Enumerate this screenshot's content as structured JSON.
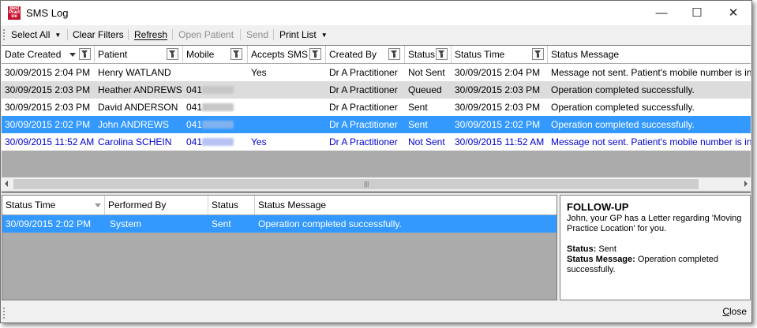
{
  "window": {
    "title": "SMS Log",
    "icon_text": "Best Practice",
    "controls": {
      "minimize": "—",
      "maximize": "☐",
      "close": "✕"
    }
  },
  "toolbar": {
    "select_all": "Select All",
    "clear_filters": "Clear Filters",
    "refresh": "Refresh",
    "open_patient": "Open Patient",
    "send": "Send",
    "print_list": "Print List"
  },
  "log_table": {
    "columns": [
      "Date Created",
      "Patient",
      "Mobile",
      "Accepts SMS",
      "Created By",
      "Status",
      "Status Time",
      "Status Message"
    ],
    "rows": [
      {
        "date": "30/09/2015 2:04 PM",
        "patient": "Henry WATLAND",
        "mobile": "",
        "accepts": "Yes",
        "created_by": "Dr A Practitioner",
        "status": "Not Sent",
        "status_time": "30/09/2015 2:04 PM",
        "message": "Message not sent. Patient's mobile number is invalid."
      },
      {
        "date": "30/09/2015 2:03 PM",
        "patient": "Heather ANDREWS",
        "mobile": "041",
        "accepts": "",
        "created_by": "Dr A Practitioner",
        "status": "Queued",
        "status_time": "30/09/2015 2:03 PM",
        "message": "Operation completed successfully."
      },
      {
        "date": "30/09/2015 2:03 PM",
        "patient": "David ANDERSON",
        "mobile": "041",
        "accepts": "",
        "created_by": "Dr A Practitioner",
        "status": "Sent",
        "status_time": "30/09/2015 2:03 PM",
        "message": "Operation completed successfully."
      },
      {
        "date": "30/09/2015 2:02 PM",
        "patient": "John ANDREWS",
        "mobile": "041",
        "accepts": "",
        "created_by": "Dr A Practitioner",
        "status": "Sent",
        "status_time": "30/09/2015 2:02 PM",
        "message": "Operation completed successfully."
      },
      {
        "date": "30/09/2015 11:52 AM",
        "patient": "Carolina SCHEIN",
        "mobile": "041",
        "accepts": "Yes",
        "created_by": "Dr A Practitioner",
        "status": "Not Sent",
        "status_time": "30/09/2015 11:52 AM",
        "message": "Message not sent. Patient's mobile number is invalid."
      }
    ]
  },
  "history_table": {
    "columns": [
      "Status Time",
      "Performed By",
      "Status",
      "Status Message"
    ],
    "rows": [
      {
        "time": "30/09/2015 2:02 PM",
        "by": "System",
        "status": "Sent",
        "message": "Operation completed successfully."
      }
    ]
  },
  "detail": {
    "heading": "FOLLOW-UP",
    "body": "John, your GP has a Letter regarding 'Moving Practice Location' for you.",
    "status_label": "Status:",
    "status_value": "Sent",
    "message_label": "Status Message:",
    "message_value": "Operation completed successfully."
  },
  "footer": {
    "close": "Close"
  },
  "colors": {
    "selection": "#3399ff",
    "unread_text": "#0000cc",
    "alt_row": "#dcdcdc",
    "grid_bg": "#ababab"
  }
}
